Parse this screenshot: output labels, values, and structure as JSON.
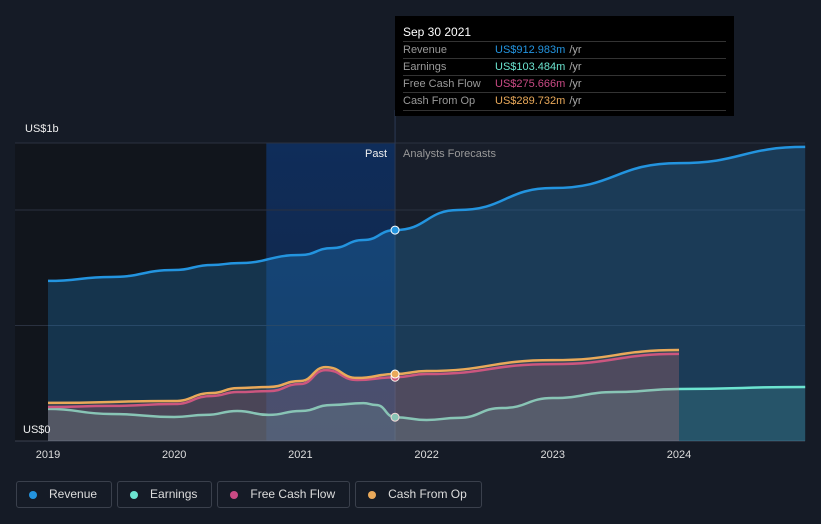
{
  "chart_data": {
    "type": "area",
    "ylabel_top": "US$1b",
    "ylabel_bottom": "US$0",
    "ylim": [
      0,
      1.29
    ],
    "xlim": [
      2018.78,
      2025.0
    ],
    "x_ticks": [
      "2019",
      "2020",
      "2021",
      "2022",
      "2023",
      "2024"
    ],
    "past_label": "Past",
    "forecast_label": "Analysts Forecasts",
    "colors": {
      "Revenue": "#2394df",
      "Earnings": "#6ce4d0",
      "Free Cash Flow": "#c94a84",
      "Cash From Op": "#e9a95a"
    },
    "series": [
      {
        "name": "Revenue",
        "x": [
          2019,
          2019.5,
          2020,
          2020.3,
          2020.5,
          2021,
          2021.25,
          2021.5,
          2021.75,
          2022.25,
          2023,
          2024,
          2025
        ],
        "values": [
          0.693,
          0.71,
          0.74,
          0.762,
          0.77,
          0.805,
          0.835,
          0.87,
          0.913,
          1.0,
          1.095,
          1.203,
          1.273
        ]
      },
      {
        "name": "Earnings",
        "x": [
          2019,
          2019.5,
          2020,
          2020.25,
          2020.5,
          2020.75,
          2021,
          2021.25,
          2021.5,
          2021.6,
          2021.75,
          2022,
          2022.25,
          2022.6,
          2023,
          2023.5,
          2024,
          2025
        ],
        "values": [
          0.139,
          0.117,
          0.104,
          0.113,
          0.13,
          0.113,
          0.13,
          0.156,
          0.164,
          0.156,
          0.103,
          0.091,
          0.1,
          0.143,
          0.186,
          0.212,
          0.225,
          0.234
        ]
      },
      {
        "name": "Free Cash Flow",
        "x": [
          2019,
          2019.5,
          2020,
          2020.3,
          2020.5,
          2020.75,
          2021,
          2021.2,
          2021.45,
          2021.75,
          2022,
          2023,
          2024
        ],
        "values": [
          0.147,
          0.152,
          0.16,
          0.195,
          0.212,
          0.216,
          0.247,
          0.307,
          0.264,
          0.276,
          0.29,
          0.333,
          0.377
        ]
      },
      {
        "name": "Cash From Op",
        "x": [
          2019,
          2020,
          2020.3,
          2020.5,
          2020.75,
          2021,
          2021.2,
          2021.45,
          2021.75,
          2022,
          2023,
          2024
        ],
        "values": [
          0.165,
          0.173,
          0.208,
          0.229,
          0.234,
          0.26,
          0.32,
          0.273,
          0.29,
          0.303,
          0.35,
          0.394
        ]
      }
    ],
    "tooltip": {
      "date": "Sep 30 2021",
      "rows": [
        {
          "label": "Revenue",
          "value": "US$912.983m",
          "unit": "/yr"
        },
        {
          "label": "Earnings",
          "value": "US$103.484m",
          "unit": "/yr"
        },
        {
          "label": "Free Cash Flow",
          "value": "US$275.666m",
          "unit": "/yr"
        },
        {
          "label": "Cash From Op",
          "value": "US$289.732m",
          "unit": "/yr"
        }
      ]
    },
    "legend": [
      "Revenue",
      "Earnings",
      "Free Cash Flow",
      "Cash From Op"
    ]
  }
}
